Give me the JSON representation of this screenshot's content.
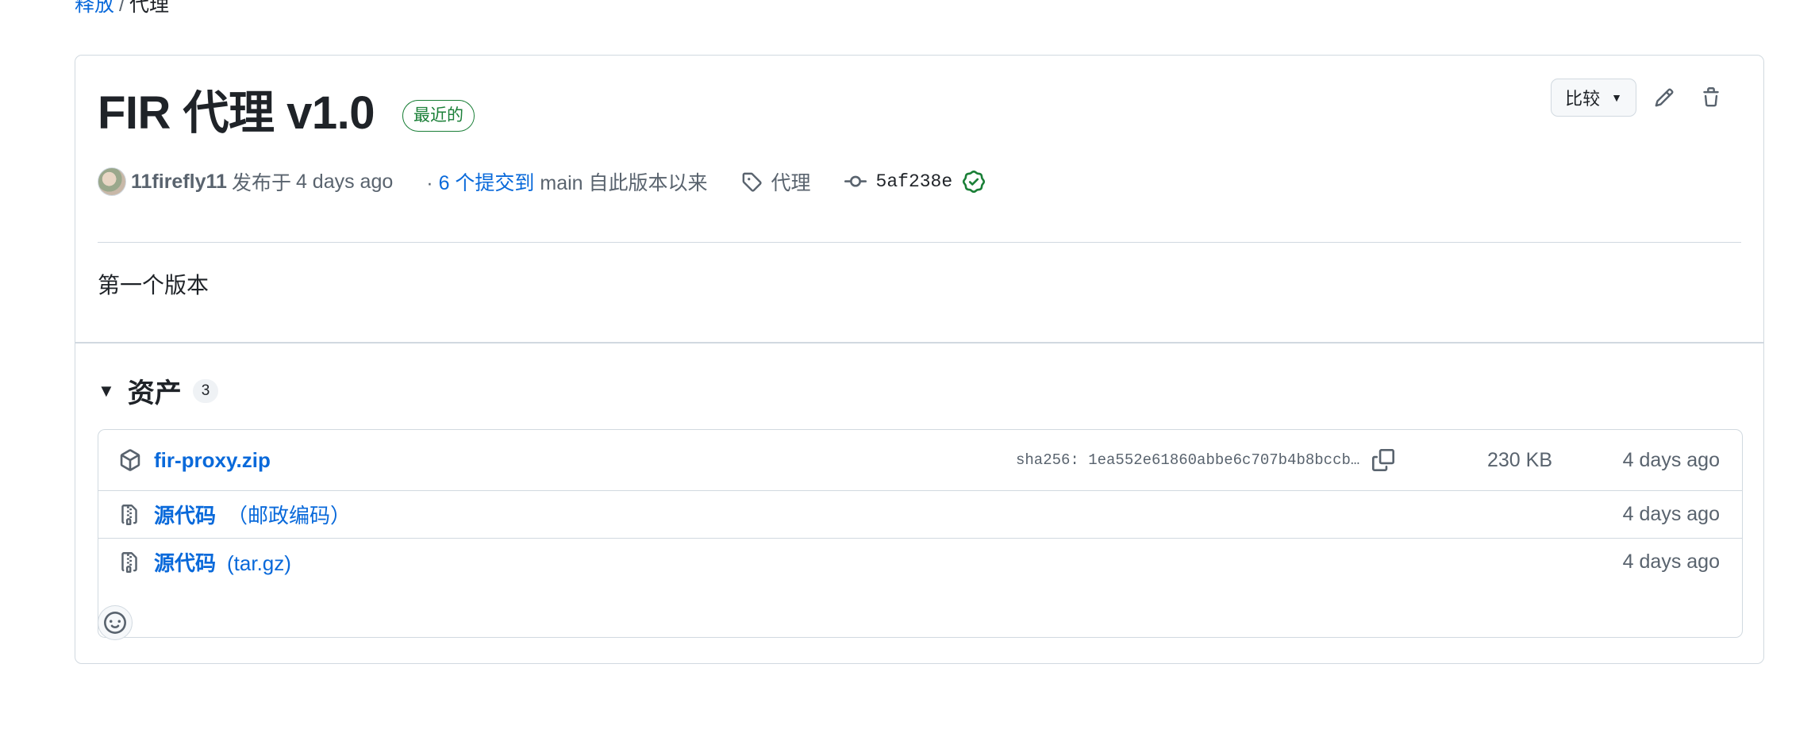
{
  "breadcrumb": {
    "parent": "释放",
    "separator": "/",
    "current": "代理"
  },
  "release": {
    "title": "FIR 代理 v1.0",
    "latest_label": "最近的",
    "author": "11firefly11",
    "published_prefix": "发布于",
    "published_time": "4 days ago",
    "commits_prefix": "·",
    "commits_link": "6 个提交到",
    "branch": "main",
    "commits_suffix": "自此版本以来",
    "tag": "代理",
    "commit_sha": "5af238e",
    "body": "第一个版本"
  },
  "actions": {
    "compare_label": "比较",
    "edit_icon": "pencil-icon",
    "delete_icon": "trash-icon"
  },
  "assets": {
    "title": "资产",
    "count": "3",
    "items": [
      {
        "name": "fir-proxy.zip",
        "sub": "",
        "sha": "sha256: 1ea552e61860abbe6c707b4b8bccb…",
        "size": "230 KB",
        "date": "4 days ago",
        "icon": "package-icon"
      },
      {
        "name": "源代码",
        "sub": "（邮政编码）",
        "sha": "",
        "size": "",
        "date": "4 days ago",
        "icon": "file-zip-icon"
      },
      {
        "name": "源代码",
        "sub": "(tar.gz)",
        "sha": "",
        "size": "",
        "date": "4 days ago",
        "icon": "file-zip-icon"
      }
    ]
  },
  "colors": {
    "link": "#0969da",
    "success": "#1a7f37",
    "border": "#d1d9e0",
    "muted": "#59636e"
  }
}
